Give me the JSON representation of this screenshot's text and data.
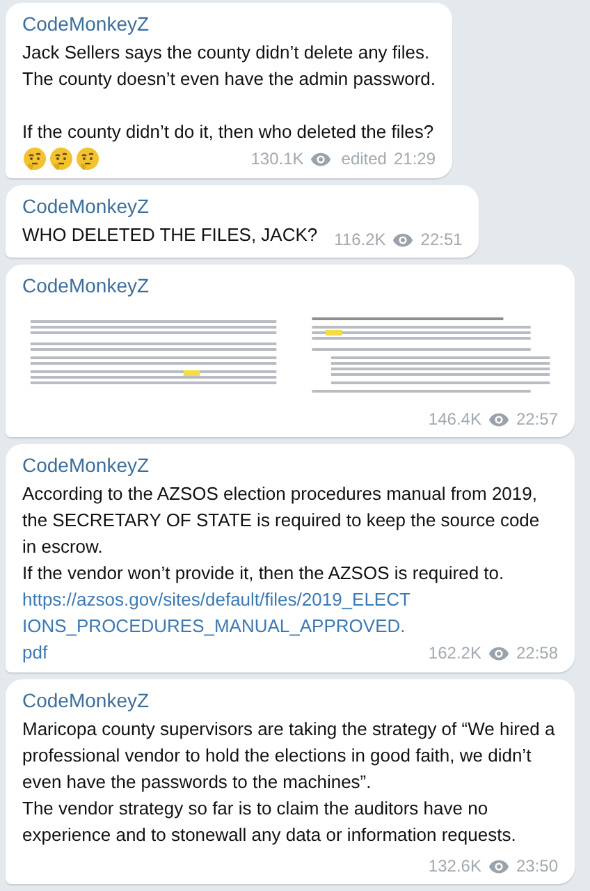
{
  "messages": [
    {
      "kind": "text",
      "author": "CodeMonkeyZ",
      "paragraphs": [
        {
          "kind": "text",
          "text": "Jack Sellers says the county didn’t delete any files.\nThe county doesn’t even have the admin password."
        },
        {
          "kind": "gap"
        },
        {
          "kind": "text",
          "text": "If the county didn’t do it, then who deleted the files?"
        }
      ],
      "emojis": [
        {
          "kind": "thinking"
        },
        {
          "kind": "thinking"
        },
        {
          "kind": "thinking"
        }
      ],
      "views": "130.1K",
      "edited": "edited",
      "time": "21:29"
    },
    {
      "kind": "text",
      "author": "CodeMonkeyZ",
      "paragraphs": [
        {
          "kind": "text",
          "text": "WHO DELETED THE FILES, JACK?"
        }
      ],
      "views": "116.2K",
      "time": "22:51"
    },
    {
      "author": "CodeMonkeyZ",
      "views": "146.4K",
      "time": "22:57"
    },
    {
      "kind": "text",
      "author": "CodeMonkeyZ",
      "paragraphs": [
        {
          "kind": "text",
          "text": "According to the AZSOS election procedures manual from 2019, the SECRETARY OF STATE is required to keep the source code in escrow.\nIf the vendor won’t provide it, then the AZSOS is required to."
        },
        {
          "kind": "link",
          "text": "https://azsos.gov/sites/default/files/2019_ELECTIONS_PROCEDURES_MANUAL_APPROVED.pdf"
        }
      ],
      "views": "162.2K",
      "time": "22:58"
    },
    {
      "kind": "text",
      "author": "CodeMonkeyZ",
      "paragraphs": [
        {
          "kind": "text",
          "text": "Maricopa county supervisors are taking the strategy of “We hired a professional vendor to hold the elections in good faith, we didn’t even have the passwords to the machines”.\nThe vendor strategy so far is to claim the auditors have no experience and to stonewall any data or information requests."
        }
      ],
      "views": "132.6K",
      "time": "23:50"
    }
  ]
}
